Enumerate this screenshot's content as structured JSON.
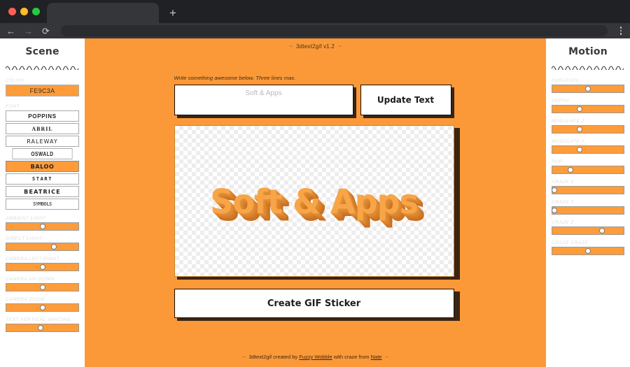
{
  "browser": {
    "new_tab_glyph": "+",
    "back_glyph": "←",
    "forward_glyph": "→",
    "reload_glyph": "⟳",
    "tab_title": "",
    "address_value": "",
    "address_placeholder": ""
  },
  "scene": {
    "title": "Scene",
    "color_label": "COLOR",
    "color_value": "FE9C3A",
    "color_hex": "#FE9C3A",
    "font_label": "FONT",
    "fonts": [
      {
        "label": "POPPINS",
        "active": false
      },
      {
        "label": "ABRIL",
        "active": false
      },
      {
        "label": "RALEWAY",
        "active": false
      },
      {
        "label": "OSWALD",
        "active": false
      },
      {
        "label": "BALOO",
        "active": true
      },
      {
        "label": "START",
        "active": false
      },
      {
        "label": "BEATRICE",
        "active": false
      },
      {
        "label": "SYMBOLS",
        "active": false
      }
    ],
    "sliders": [
      {
        "label": "AMBIENT LIGHT",
        "value": 50
      },
      {
        "label": "DIRECT LIGHT",
        "value": 66
      },
      {
        "label": "CAMERA LEFT-RIGHT",
        "value": 50
      },
      {
        "label": "CAMERA UP-DOWN",
        "value": 50
      },
      {
        "label": "CAMERA ZOOM",
        "value": 50
      },
      {
        "label": "TEXT VERTICAL SPACING",
        "value": 48
      }
    ]
  },
  "motion": {
    "title": "Motion",
    "sliders": [
      {
        "label": "DURATION",
        "value": 50
      },
      {
        "label": "DEPTH",
        "value": 38
      },
      {
        "label": "MODULATE Z",
        "value": 38
      },
      {
        "label": "MODULATE Y",
        "value": 38
      },
      {
        "label": "POP",
        "value": 25
      },
      {
        "label": "CRAZE X",
        "value": 3
      },
      {
        "label": "CRAZE Y",
        "value": 3
      },
      {
        "label": "CRAZE Z",
        "value": 70
      },
      {
        "label": "CRAZE CRAZE",
        "value": 50
      }
    ]
  },
  "app": {
    "title": "3dtext2gif v1.2",
    "dash": "~",
    "helper_text": "Write something awesome below. Three lines max.",
    "text_input_placeholder": "Soft & Apps",
    "text_input_value": "",
    "update_button": "Update Text",
    "preview_text": "Soft & Apps",
    "create_button": "Create GIF Sticker",
    "footer_prefix": "3dtext2gif created by ",
    "footer_link1": "Fuzzy Wobble",
    "footer_middle": " with craze from ",
    "footer_link2": "Nate",
    "background_hex": "#FB9939"
  }
}
